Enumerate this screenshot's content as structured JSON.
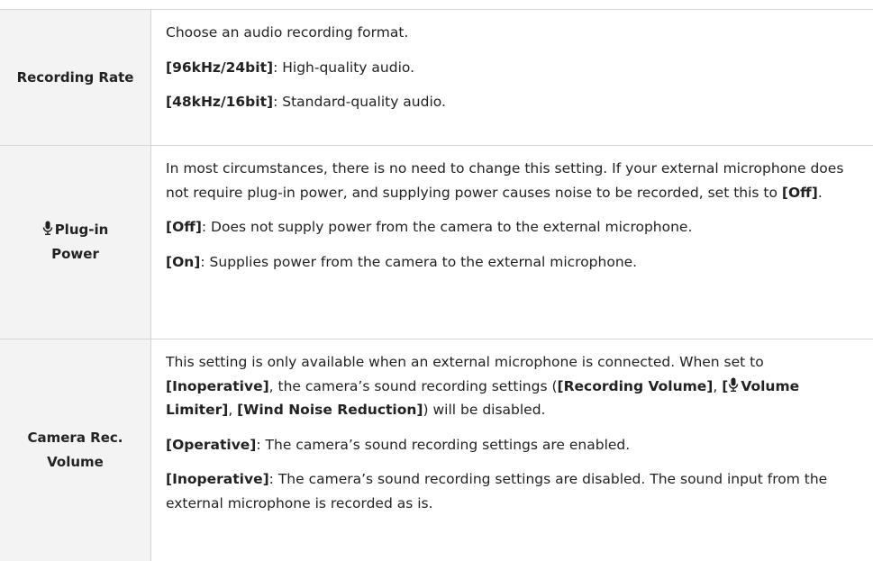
{
  "rows": [
    {
      "label": "Recording Rate",
      "intro": "Choose an audio recording format.",
      "options": [
        {
          "key": "[96kHz/24bit]",
          "desc": ": High-quality audio."
        },
        {
          "key": "[48kHz/16bit]",
          "desc": ": Standard-quality audio."
        }
      ]
    },
    {
      "label": "Plug-in Power",
      "icon": "microphone-icon",
      "intro": "In most circumstances, there is no need to change this setting. If your external microphone does not require plug-in power, and supplying power causes noise to be recorded, set this to ",
      "intro_key": "[Off]",
      "intro_end": ".",
      "options": [
        {
          "key": "[Off]",
          "desc": ": Does not supply power from the camera to the external microphone."
        },
        {
          "key": "[On]",
          "desc": ": Supplies power from the camera to the external microphone."
        }
      ]
    },
    {
      "label": "Camera Rec. Volume",
      "intro_a": "This setting is only available when an external microphone is connected. When set to ",
      "intro_key_a": "[Inoperative]",
      "intro_b": ", the camera’s sound recording settings (",
      "intro_key_b": "[Recording Volume]",
      "intro_c": ", ",
      "intro_key_c_open": "[",
      "intro_key_c_text": "Volume Limiter]",
      "intro_d": ", ",
      "intro_key_d": "[Wind Noise Reduction]",
      "intro_e": ") will be disabled.",
      "options": [
        {
          "key": "[Operative]",
          "desc": ": The camera’s sound recording settings are enabled."
        },
        {
          "key": "[Inoperative]",
          "desc": ": The camera’s sound recording settings are disabled. The sound input from the external microphone is recorded as is."
        }
      ]
    }
  ]
}
